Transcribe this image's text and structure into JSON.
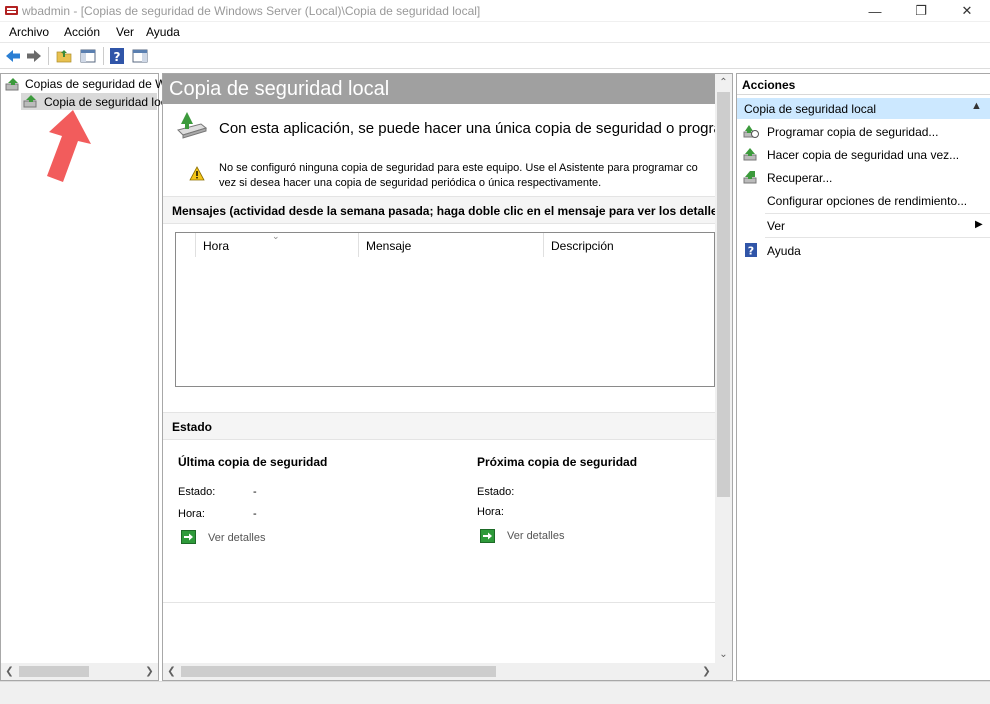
{
  "window": {
    "title": "wbadmin - [Copias de seguridad de Windows Server (Local)\\Copia de seguridad local]",
    "minimize": "—",
    "maximize": "❐",
    "close": "✕"
  },
  "menu": [
    "Archivo",
    "Acción",
    "Ver",
    "Ayuda"
  ],
  "tree": {
    "root": "Copias de seguridad de W",
    "child": "Copia de seguridad loc"
  },
  "center": {
    "title": "Copia de seguridad local",
    "intro": "Con esta aplicación, se puede hacer una única copia de seguridad o progra",
    "warning_line1": "No se configuró ninguna copia de seguridad para este equipo. Use el Asistente para programar co",
    "warning_line2": "vez si desea hacer una copia de seguridad periódica o única respectivamente.",
    "messages_header": "Mensajes (actividad desde la semana pasada; haga doble clic en el mensaje para ver los detalles)",
    "columns": [
      "Hora",
      "Mensaje",
      "Descripción"
    ],
    "status_header": "Estado",
    "last_backup": {
      "title": "Última copia de seguridad",
      "estado_label": "Estado:",
      "estado_value": "-",
      "hora_label": "Hora:",
      "hora_value": "-",
      "details": "Ver detalles"
    },
    "next_backup": {
      "title": "Próxima copia de seguridad",
      "estado_label": "Estado:",
      "hora_label": "Hora:",
      "details": "Ver detalles"
    }
  },
  "actions": {
    "header": "Acciones",
    "section": "Copia de seguridad local",
    "items": [
      "Programar copia de seguridad...",
      "Hacer copia de seguridad una vez...",
      "Recuperar...",
      "Configurar opciones de rendimiento...",
      "Ver",
      "Ayuda"
    ]
  },
  "colors": {
    "accent_selected": "#cce8ff",
    "header_gray": "#a0a0a0",
    "annotation_arrow": "#f25c5c"
  }
}
